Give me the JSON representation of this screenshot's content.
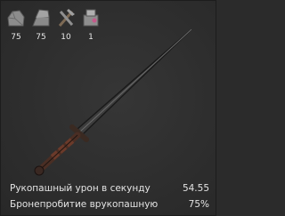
{
  "costs": [
    {
      "icon": "stone-resource-icon",
      "value": "75"
    },
    {
      "icon": "iron-ingot-resource-icon",
      "value": "75"
    },
    {
      "icon": "tools-resource-icon",
      "value": "10"
    },
    {
      "icon": "components-resource-icon",
      "value": "1"
    }
  ],
  "weapon": {
    "icon": "sword-item-icon"
  },
  "stats": [
    {
      "label": "Рукопашный урон в секунду",
      "value": "54.55"
    },
    {
      "label": "Бронепробитие врукопашную",
      "value": "75%"
    }
  ]
}
